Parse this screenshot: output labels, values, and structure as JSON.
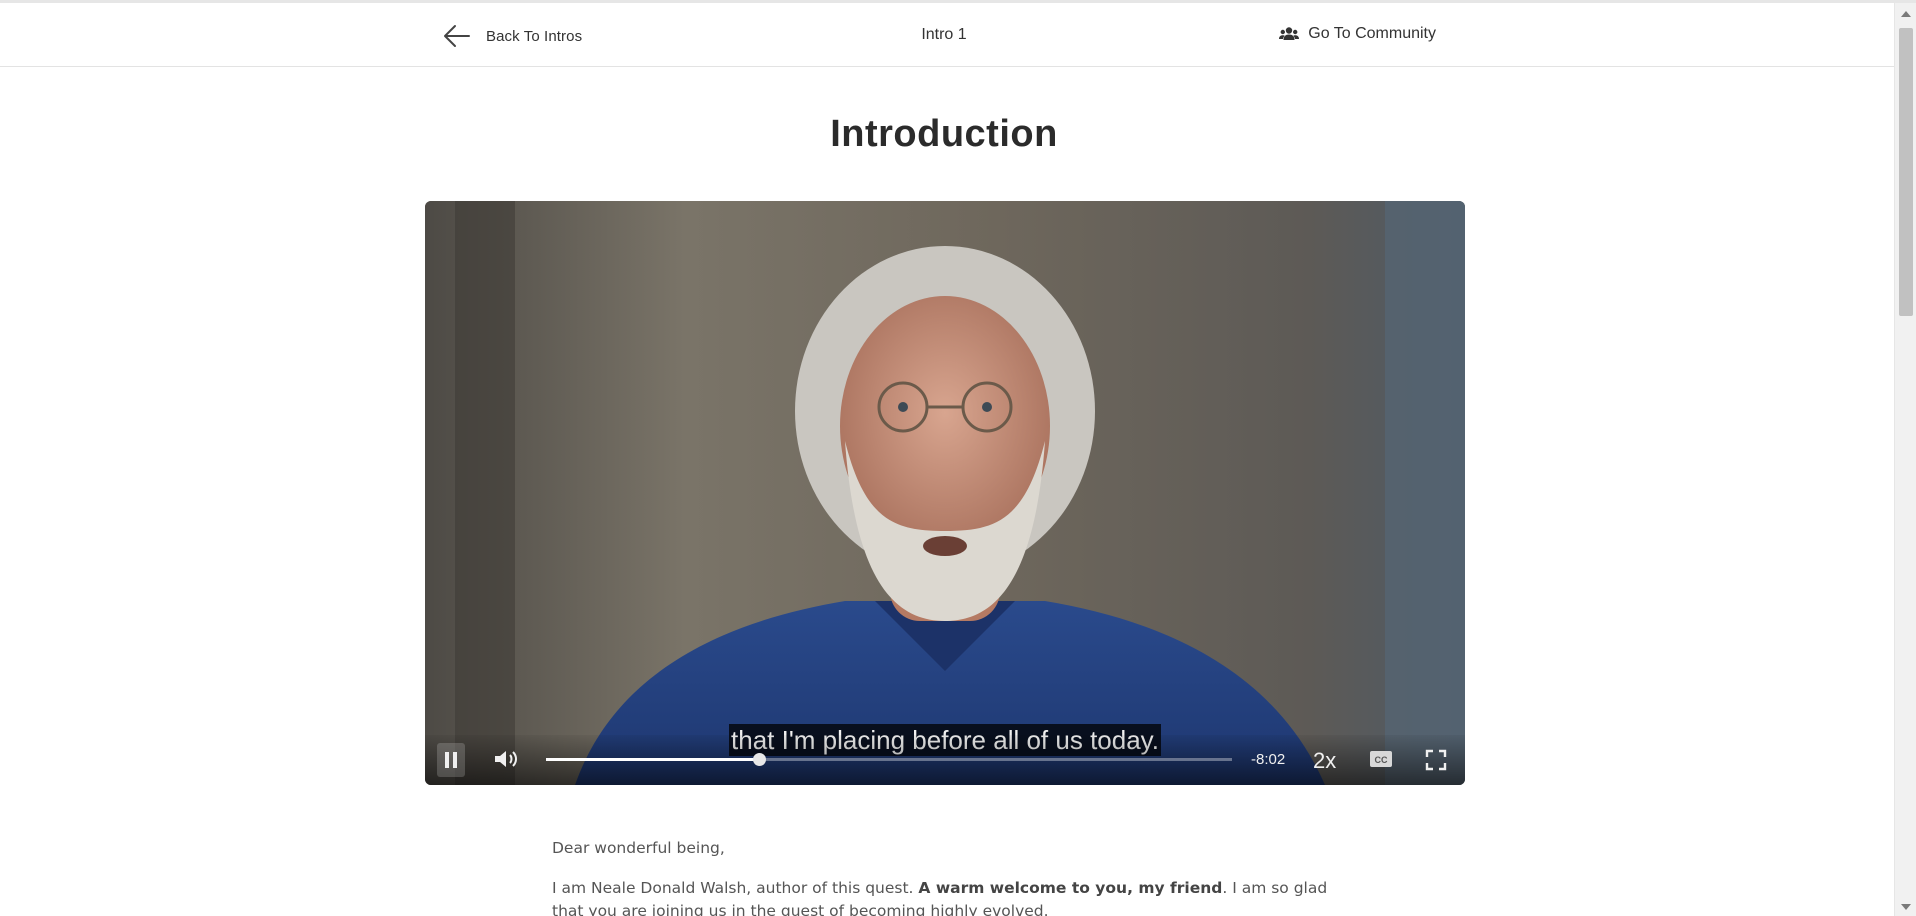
{
  "header": {
    "back_label": "Back To Intros",
    "intro_title": "Intro 1",
    "community_label": "Go To Community"
  },
  "page": {
    "title": "Introduction"
  },
  "video": {
    "caption": "that I'm placing before all of us today.",
    "time_remaining": "-8:02",
    "speed": "2x",
    "progress": 0.31,
    "state": "playing",
    "captions_on": true
  },
  "content": {
    "greeting": "Dear wonderful being,",
    "para1_start": "I am Neale Donald Walsh, author of this quest. ",
    "para1_bold": "A warm welcome to you, my friend",
    "para1_end": ". I am so glad that you are joining us in the quest of becoming highly evolved."
  },
  "icons": {
    "back": "arrow-left-icon",
    "community": "users-icon",
    "pause": "pause-icon",
    "volume": "volume-icon",
    "captions": "closed-captions-icon",
    "fullscreen": "fullscreen-icon"
  },
  "colors": {
    "text_dark": "#2b2b2b",
    "body_text": "#555555",
    "video_overlay": "#000000"
  }
}
